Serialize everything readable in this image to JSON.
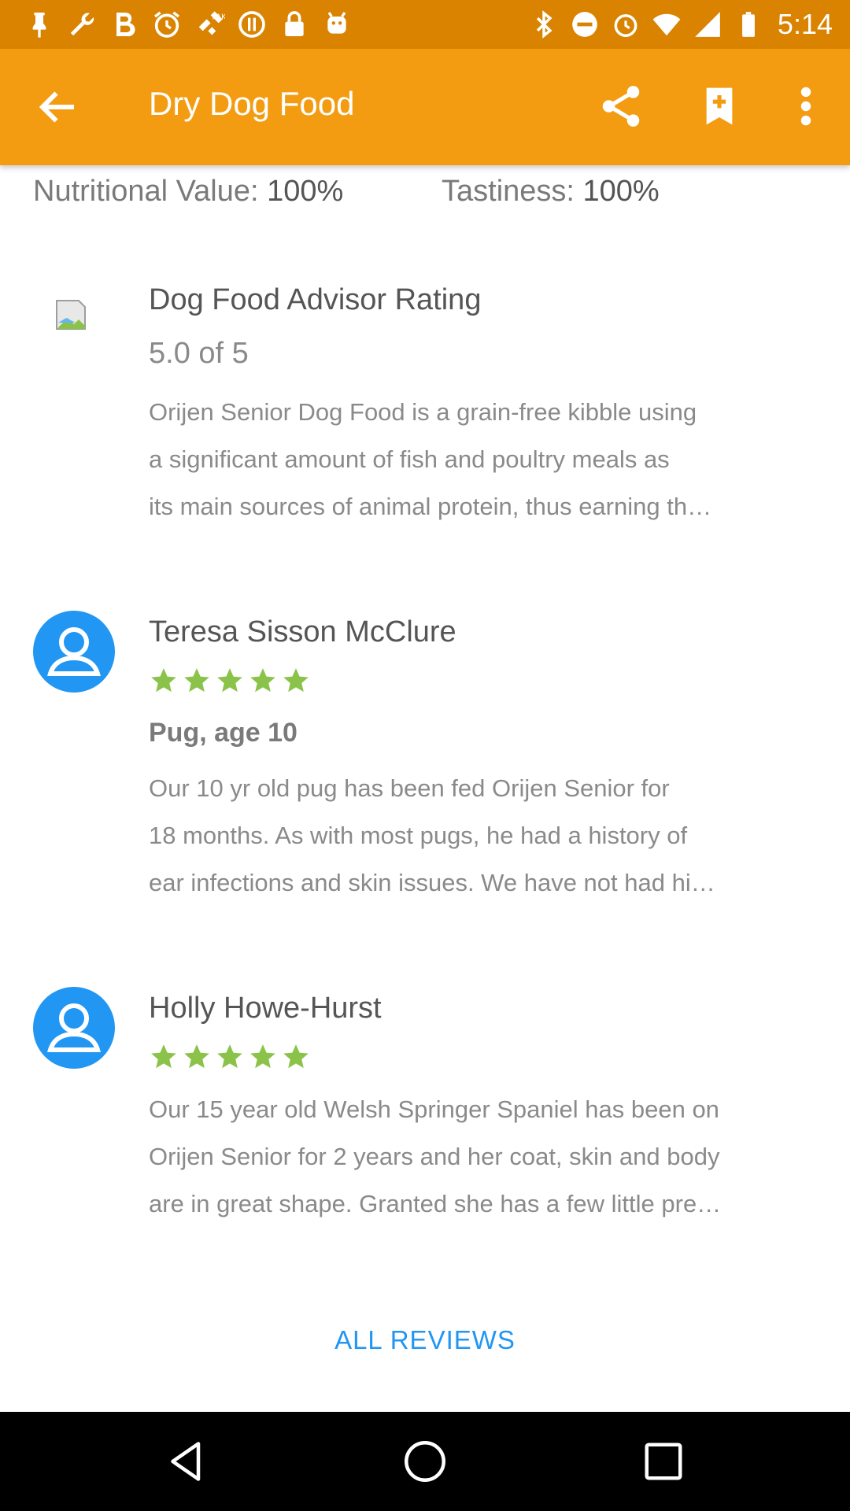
{
  "status_bar": {
    "time": "5:14"
  },
  "app_bar": {
    "title": "Dry Dog Food"
  },
  "stats": {
    "nutrition_label": "Nutritional Value:",
    "nutrition_value": "100%",
    "taste_label": "Tastiness:",
    "taste_value": "100%"
  },
  "advisor": {
    "title": "Dog Food Advisor Rating",
    "rating": "5.0 of 5",
    "lines": [
      "Orijen Senior Dog Food is a grain-free kibble using",
      "a significant amount of fish and poultry meals as",
      "its main sources of animal protein, thus earning th…"
    ]
  },
  "reviews": [
    {
      "name": "Teresa Sisson McClure",
      "stars": 5,
      "subtitle": "Pug, age 10",
      "lines": [
        "Our 10 yr old pug has been fed Orijen Senior for",
        "18 months. As with most pugs, he had a history of",
        "ear infections and skin issues. We have not had hi…"
      ]
    },
    {
      "name": "Holly Howe-Hurst",
      "stars": 5,
      "lines": [
        "Our 15 year old Welsh Springer Spaniel has been on",
        "Orijen Senior for 2 years and her coat, skin and body",
        "are in great shape.  Granted she has a few little pre…"
      ]
    }
  ],
  "all_reviews_label": "ALL REVIEWS",
  "colors": {
    "app_bar": "#f39c12",
    "status_bar": "#d98300",
    "star": "#8bc34a",
    "accent": "#2196f3"
  }
}
